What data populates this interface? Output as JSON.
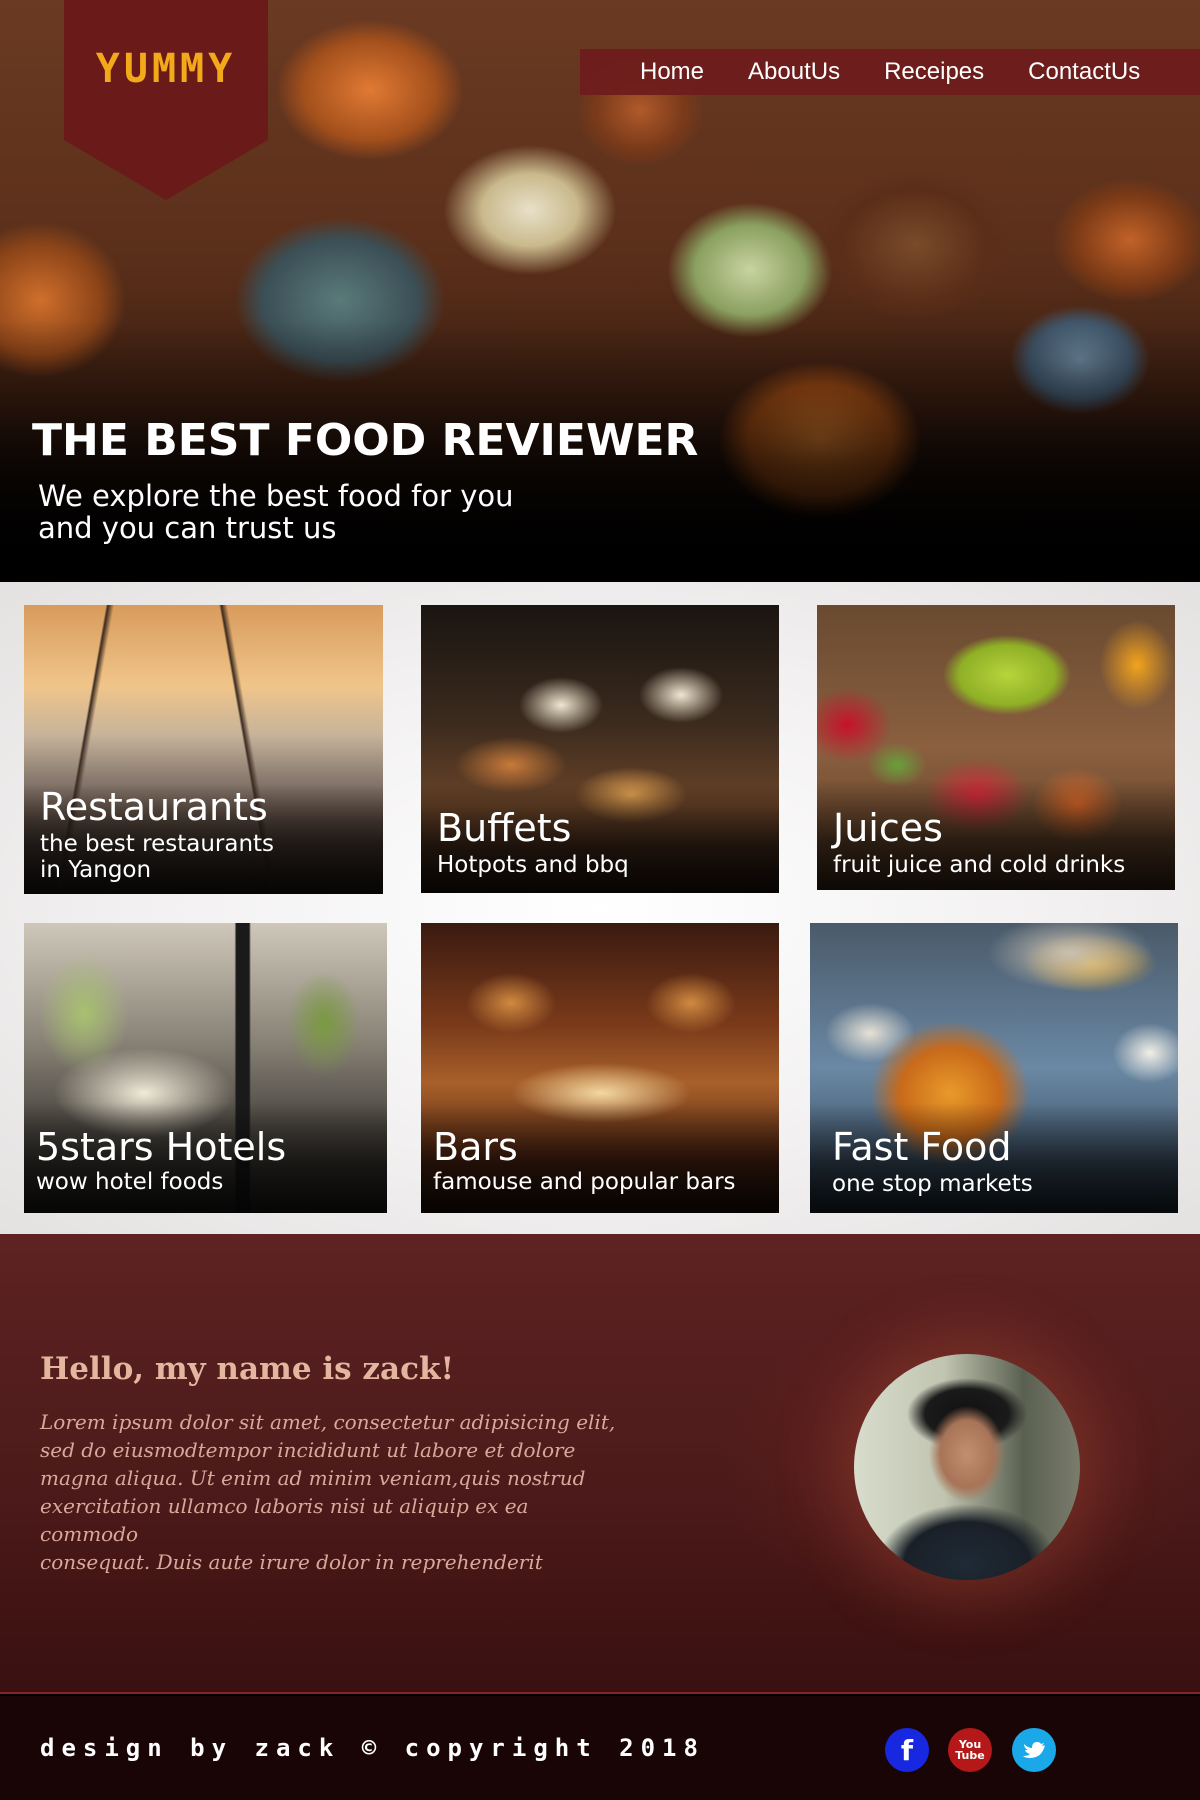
{
  "header": {
    "logo": "YUMMY",
    "nav": [
      "Home",
      "AboutUs",
      "Receipes",
      "ContactUs"
    ]
  },
  "hero": {
    "title": "THE BEST FOOD REVIEWER",
    "subtitle_line1": "We explore the best food for you",
    "subtitle_line2": "and you can trust us"
  },
  "cards": [
    {
      "title": "Restaurants",
      "subtitle_line1": "the best restaurants",
      "subtitle_line2": "in Yangon"
    },
    {
      "title": "Buffets",
      "subtitle_line1": "Hotpots and bbq"
    },
    {
      "title": "Juices",
      "subtitle_line1": "fruit juice and cold drinks"
    },
    {
      "title": "5stars Hotels",
      "subtitle_line1": "wow hotel foods"
    },
    {
      "title": "Bars",
      "subtitle_line1": "famouse and popular bars"
    },
    {
      "title": "Fast Food",
      "subtitle_line1": "one stop markets"
    }
  ],
  "about": {
    "heading": "Hello, my name is zack!",
    "body_line1": "Lorem ipsum dolor sit amet, consectetur adipisicing elit,",
    "body_line2": "sed do eiusmodtempor incididunt ut labore et dolore",
    "body_line3": "magna aliqua. Ut enim ad minim veniam,quis nostrud",
    "body_line4": "exercitation ullamco laboris nisi ut aliquip ex ea commodo",
    "body_line5": "consequat. Duis aute irure dolor in reprehenderit"
  },
  "footer": {
    "credit": "design by zack © copyright 2018",
    "social": {
      "facebook": "f",
      "youtube_top": "You",
      "youtube_bottom": "Tube"
    }
  },
  "colors": {
    "accent": "#6e1c1c",
    "logo_text": "#f2a91a",
    "footer_bg": "#190505",
    "facebook": "#1728e0",
    "youtube": "#b51818",
    "twitter": "#1aa8e8"
  },
  "icons": {
    "facebook": "facebook-icon",
    "youtube": "youtube-icon",
    "twitter": "twitter-icon"
  }
}
